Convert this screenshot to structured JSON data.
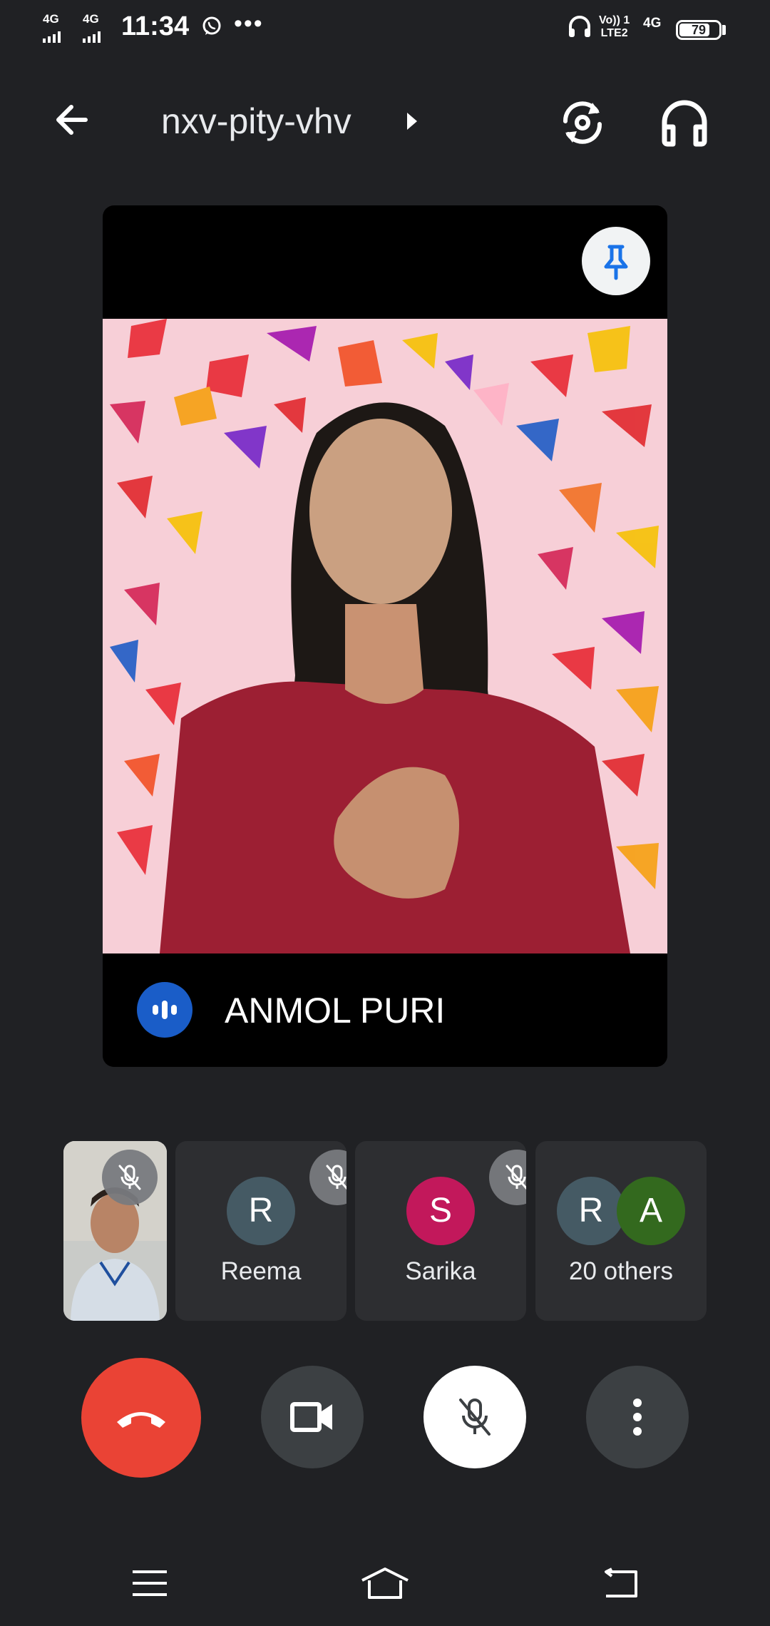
{
  "status_bar": {
    "network_1": "4G",
    "network_2": "4G",
    "time": "11:34",
    "volte_line1": "Vo)) 1",
    "volte_line2": "LTE2",
    "network_type": "4G",
    "battery_level": "79",
    "battery_fraction": 0.79
  },
  "header": {
    "meeting_code": "nxv-pity-vhv"
  },
  "main_tile": {
    "speaker_name": "ANMOL PURI"
  },
  "participants": [
    {
      "type": "self"
    },
    {
      "initial": "R",
      "name": "Reema",
      "avatar_color": "#455a64",
      "muted": true
    },
    {
      "initial": "S",
      "name": "Sarika",
      "avatar_color": "#c2185b",
      "muted": true
    },
    {
      "initials": [
        "R",
        "A"
      ],
      "name": "20 others",
      "avatar_colors": [
        "#455a64",
        "#33691e"
      ]
    }
  ],
  "controls": {
    "end_call_color": "#ea4335",
    "mic_muted": true
  },
  "colors": {
    "background": "#202124",
    "accent_blue": "#1a5dc8"
  },
  "icons": [
    "back-arrow-icon",
    "caret-right-icon",
    "switch-camera-icon",
    "headphones-icon",
    "pin-icon",
    "speaking-indicator-icon",
    "mic-off-icon",
    "end-call-icon",
    "video-camera-icon",
    "more-vertical-icon",
    "menu-icon",
    "home-icon",
    "back-icon"
  ]
}
